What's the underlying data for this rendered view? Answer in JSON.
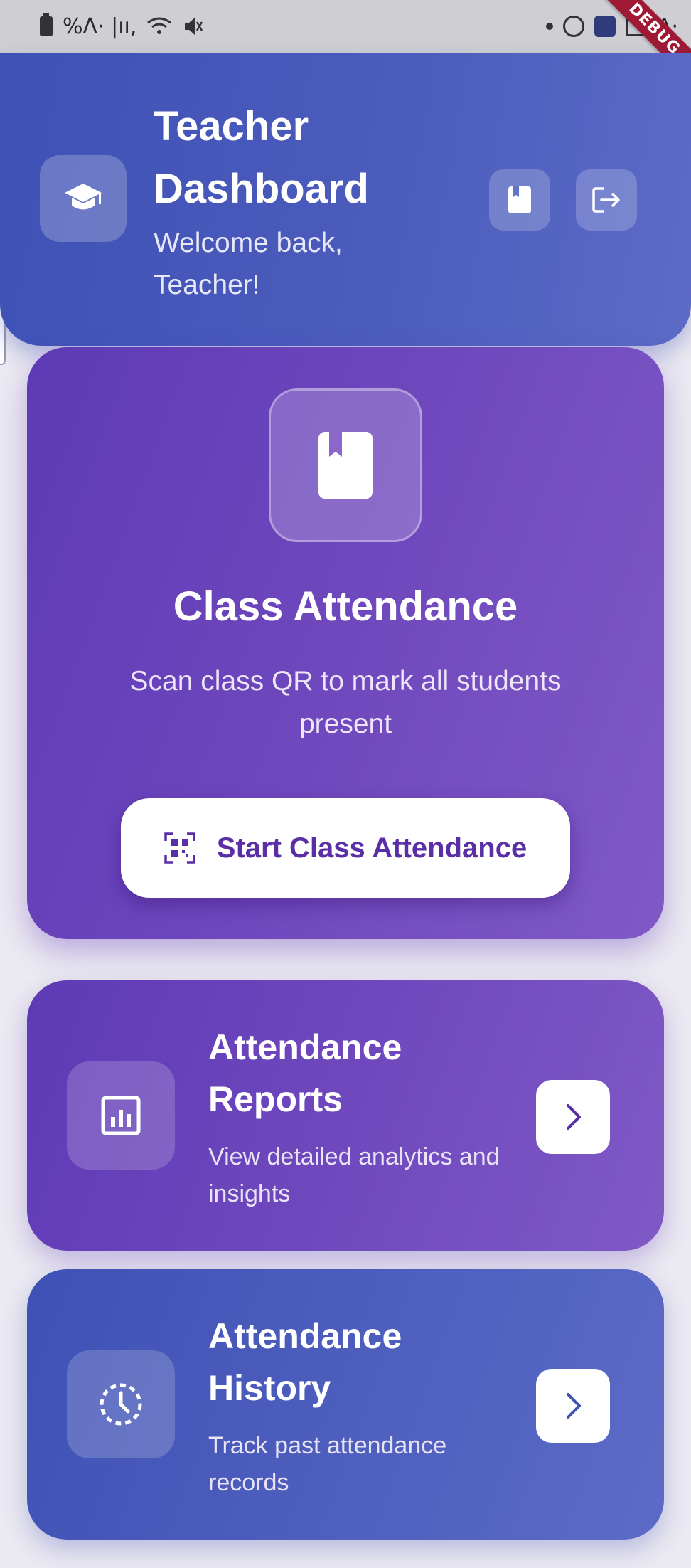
{
  "status_bar": {
    "left_glyphs": "%Λ· |ıı,",
    "right_glyphs": "A·"
  },
  "debug_banner": "DEBUG",
  "header": {
    "title": "Teacher Dashboard",
    "subtitle": "Welcome back, Teacher!",
    "icon": "graduation-cap-icon",
    "actions": [
      {
        "icon": "book-icon"
      },
      {
        "icon": "logout-icon"
      }
    ]
  },
  "class_attendance": {
    "icon": "book-icon",
    "title": "Class Attendance",
    "description": "Scan class QR to mark all students present",
    "button_label": "Start Class Attendance",
    "button_icon": "qr-code-icon"
  },
  "cards": [
    {
      "icon": "analytics-icon",
      "title": "Attendance Reports",
      "description": "View detailed analytics and insights",
      "action_icon": "chevron-right-icon"
    },
    {
      "icon": "history-clock-icon",
      "title": "Attendance History",
      "description": "Track past attendance records",
      "action_icon": "chevron-right-icon"
    }
  ],
  "colors": {
    "header": "#4b5cbc",
    "purple_card": "#6f48bd",
    "blue_card": "#4d5ebd",
    "button_text": "#5a2ea6",
    "background": "#ebe9f1"
  }
}
